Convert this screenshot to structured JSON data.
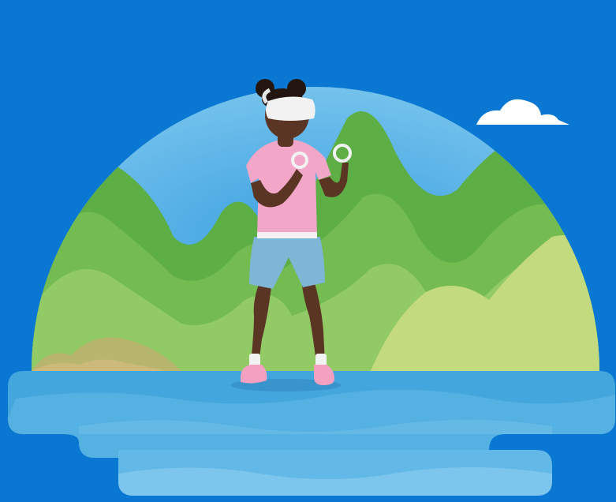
{
  "scene": {
    "subject": "person-wearing-vr-headset",
    "colors": {
      "background": "#0a78d2",
      "sky": "#6fc0ec",
      "sky_deep": "#3a9fe0",
      "cloud": "#ffffff",
      "hills_far": "#5cae45",
      "hills_mid": "#7dc25a",
      "hills_near": "#a8d477",
      "hills_light": "#c6db7e",
      "ground_brown": "#b7b56e",
      "water_top": "#43a6dc",
      "water_mid": "#62b8e6",
      "water_light": "#8fcff0",
      "shirt": "#f2a6c8",
      "shorts": "#7fb6d6",
      "skin": "#5a3524",
      "headset": "#f2f2f2",
      "shoes": "#f4a0c0"
    }
  }
}
